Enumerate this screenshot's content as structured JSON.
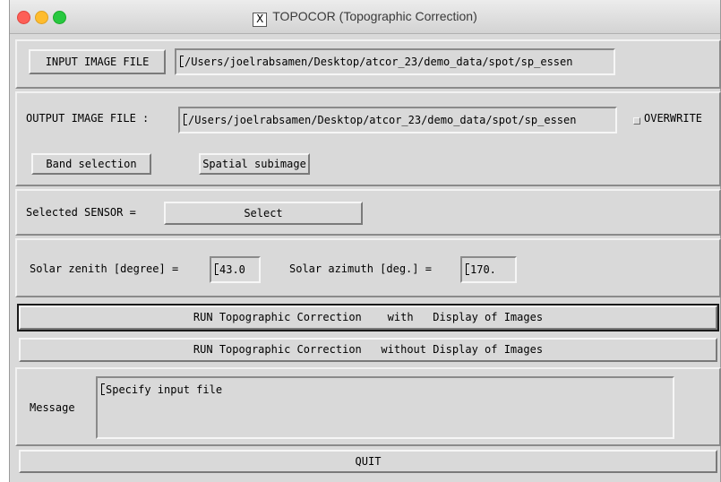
{
  "window": {
    "title": "TOPOCOR (Topographic Correction)",
    "title_icon": "x11-icon"
  },
  "input": {
    "button_label": "INPUT IMAGE FILE",
    "path": "/Users/joelrabsamen/Desktop/atcor_23/demo_data/spot/sp_essen"
  },
  "output": {
    "label": "OUTPUT IMAGE FILE :",
    "path": "/Users/joelrabsamen/Desktop/atcor_23/demo_data/spot/sp_essen",
    "overwrite_label": "OVERWRITE",
    "overwrite_checked": false,
    "band_selection_label": "Band selection",
    "spatial_subimage_label": "Spatial subimage"
  },
  "sensor": {
    "label": "Selected SENSOR =",
    "select_label": "Select"
  },
  "solar": {
    "zenith_label": "Solar zenith [degree] =",
    "zenith_value": "43.0",
    "azimuth_label": "Solar azimuth [deg.] =",
    "azimuth_value": "170."
  },
  "run": {
    "with_display_label": "RUN Topographic Correction    with   Display of Images",
    "without_display_label": "RUN Topographic Correction   without Display of Images"
  },
  "message": {
    "label": "Message",
    "text": "Specify input file"
  },
  "quit_label": "QUIT"
}
